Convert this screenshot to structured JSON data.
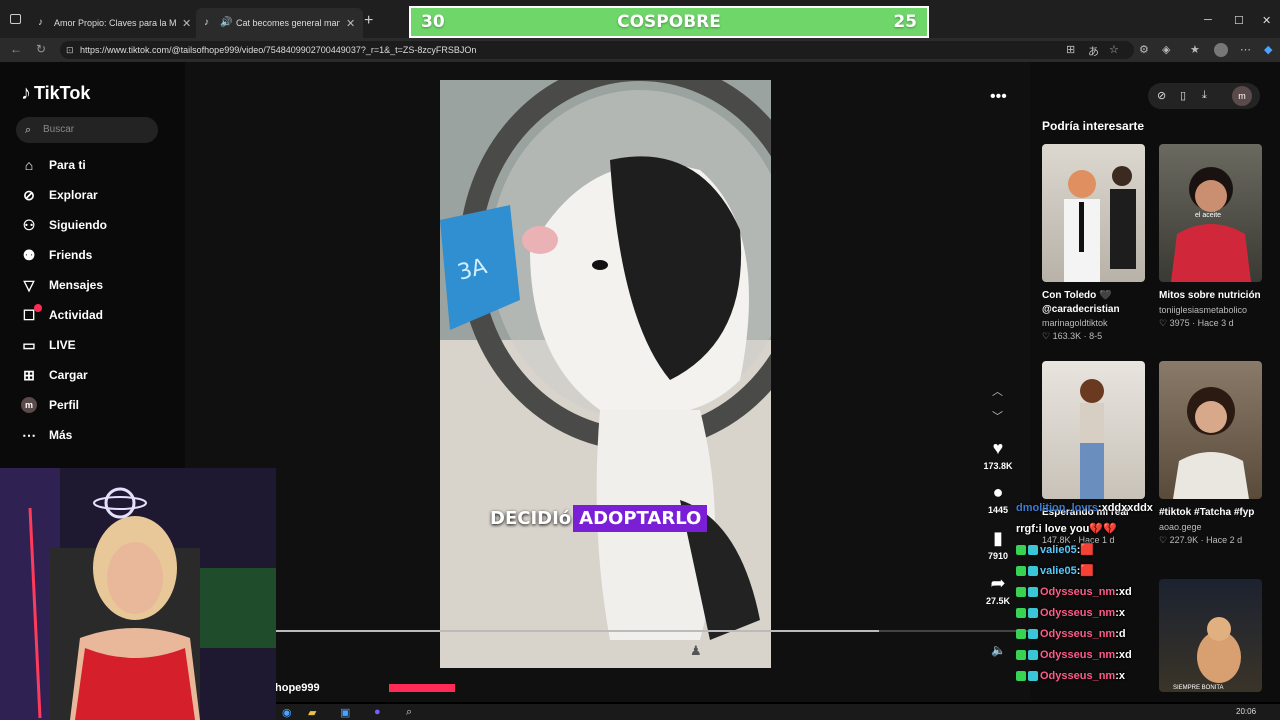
{
  "browser": {
    "tabs": [
      {
        "title": "Amor Propio: Claves para la Motiva",
        "active": false
      },
      {
        "title": "Cat becomes general manager",
        "active": true
      }
    ],
    "url": "https://www.tiktok.com/@tailsofhope999/video/7548409902700449037?_r=1&_t=ZS-8zcyFRSBJOn"
  },
  "scoreboard": {
    "left": "30",
    "title": "COSPOBRE",
    "right": "25",
    "color": "#6fd76a"
  },
  "tiktok": {
    "logo": "TikTok",
    "search_placeholder": "Buscar",
    "menu": [
      {
        "label": "Para ti",
        "icon": "home-icon"
      },
      {
        "label": "Explorar",
        "icon": "compass-icon"
      },
      {
        "label": "Siguiendo",
        "icon": "following-icon"
      },
      {
        "label": "Friends",
        "icon": "friends-icon"
      },
      {
        "label": "Mensajes",
        "icon": "messages-icon"
      },
      {
        "label": "Actividad",
        "icon": "activity-icon"
      },
      {
        "label": "LIVE",
        "icon": "live-icon"
      },
      {
        "label": "Cargar",
        "icon": "upload-icon"
      },
      {
        "label": "Perfil",
        "icon": "avatar"
      },
      {
        "label": "Más",
        "icon": "more-icon"
      }
    ],
    "profile_initial": "m",
    "video": {
      "caption_white": "DECIDIó",
      "caption_highlight": "ADOPTARLO",
      "handle_partial": "hope999",
      "progress": 0.8
    },
    "actions": {
      "likes": "173.8K",
      "comments": "1445",
      "saves": "7910",
      "shares": "27.5K"
    },
    "recommendations": {
      "title": "Podría interesarte",
      "items": [
        {
          "line1": "Con Toledo 🖤",
          "line2": "@caradecristian",
          "author": "marinagoldtiktok",
          "stats": "♡ 163.3K · 8-5"
        },
        {
          "line1": "Mitos sobre nutrición",
          "line2": "",
          "author": "toniiglesiasmetabolico",
          "stats": "♡ 3975 · Hace 3 d"
        },
        {
          "line1": "Esperando mi real",
          "line2": "",
          "author": "",
          "stats": "147.8K · Hace 1 d"
        },
        {
          "line1": "#tiktok #Tatcha #fyp",
          "line2": "",
          "author": "aoao.gege",
          "stats": "♡ 227.9K · Hace 2 d"
        }
      ],
      "thumb_text": [
        "el aceite",
        "SIEMPRE BONITA"
      ]
    }
  },
  "chat": [
    {
      "user": "dmolition_lovrs",
      "msg": "xddxxddx",
      "color": "#3a7bd5"
    },
    {
      "user": "rrgf",
      "msg": "i love you💔💔",
      "color": "#ffffff"
    },
    {
      "user": "valie05",
      "msg": "🟥",
      "color": "#5ac8fa"
    },
    {
      "user": "valie05",
      "msg": "🟥",
      "color": "#5ac8fa"
    },
    {
      "user": "Odysseus_nm",
      "msg": "xd",
      "color": "#ff5a8a"
    },
    {
      "user": "Odysseus_nm",
      "msg": "x",
      "color": "#ff5a8a"
    },
    {
      "user": "Odysseus_nm",
      "msg": "d",
      "color": "#ff5a8a"
    },
    {
      "user": "Odysseus_nm",
      "msg": "xd",
      "color": "#ff5a8a"
    },
    {
      "user": "Odysseus_nm",
      "msg": "x",
      "color": "#ff5a8a"
    }
  ],
  "taskbar": {
    "clock": "20:06"
  }
}
